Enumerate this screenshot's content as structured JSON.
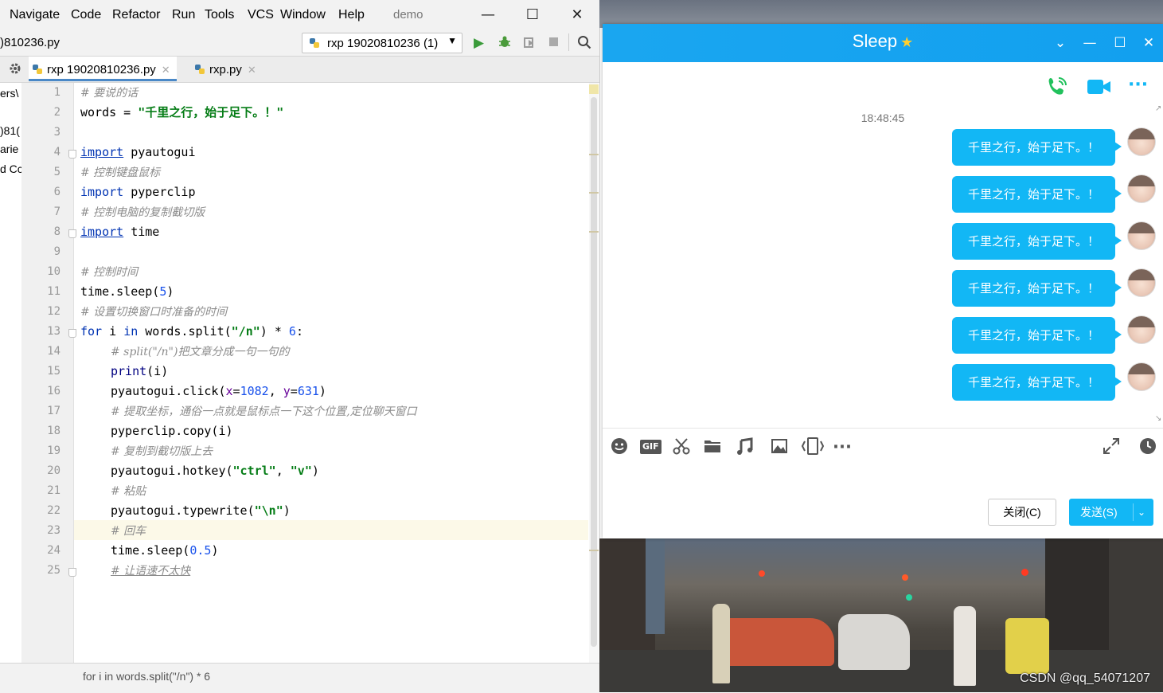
{
  "ide": {
    "menu": [
      "Navigate",
      "Code",
      "Refactor",
      "Run",
      "Tools",
      "VCS",
      "Window",
      "Help"
    ],
    "project": "demo",
    "window_controls": {
      "minimize": "—",
      "maximize": "☐",
      "close": "✕"
    },
    "nav_file": ")810236.py",
    "run_config": "rxp 19020810236 (1)",
    "tabs": [
      {
        "label": "rxp 19020810236.py",
        "close": "✕"
      },
      {
        "label": "rxp.py",
        "close": "✕"
      }
    ],
    "project_strip": [
      "ers\\",
      ")81(",
      "arie",
      "d Cc"
    ],
    "lines": [
      "1",
      "2",
      "3",
      "4",
      "5",
      "6",
      "7",
      "8",
      "9",
      "10",
      "11",
      "12",
      "13",
      "14",
      "15",
      "16",
      "17",
      "18",
      "19",
      "20",
      "21",
      "22",
      "23",
      "24",
      "25"
    ],
    "code": {
      "l1": "# 要说的话",
      "l2_a": "words = ",
      "l2_b": "\"千里之行，始于足下。！\"",
      "l4_kw": "import",
      "l4_rest": " pyautogui",
      "l5": "# 控制键盘鼠标",
      "l6_kw": "import",
      "l6_rest": " pyperclip",
      "l7": "# 控制电脑的复制截切版",
      "l8_kw": "import",
      "l8_rest": " time",
      "l10": "# 控制时间",
      "l11_a": "time.sleep(",
      "l11_num": "5",
      "l11_b": ")",
      "l12": "# 设置切换窗口时准备的时间",
      "l13_for": "for",
      "l13_a": " i ",
      "l13_in": "in",
      "l13_b": " words.split(",
      "l13_str": "\"/n\"",
      "l13_c": ") * ",
      "l13_num": "6",
      "l13_d": ":",
      "l14": "# split(\"/n\")把文章分成一句一句的",
      "l15_fn": "print",
      "l15_rest": "(i)",
      "l16_a": "pyautogui.click(",
      "l16_x": "x",
      "l16_eq1": "=",
      "l16_xv": "1082",
      "l16_sep": ", ",
      "l16_y": "y",
      "l16_eq2": "=",
      "l16_yv": "631",
      "l16_b": ")",
      "l17": "# 提取坐标，通俗一点就是鼠标点一下这个位置,定位聊天窗口",
      "l18": "pyperclip.copy(i)",
      "l19": "# 复制到截切版上去",
      "l20_a": "pyautogui.hotkey(",
      "l20_s1": "\"ctrl\"",
      "l20_sep": ", ",
      "l20_s2": "\"v\"",
      "l20_b": ")",
      "l21": "# 粘贴",
      "l22_a": "pyautogui.typewrite(",
      "l22_s": "\"\\n\"",
      "l22_b": ")",
      "l23": "# 回车",
      "l24_a": "time.sleep(",
      "l24_num": "0.5",
      "l24_b": ")",
      "l25": "# 让语速不太快"
    },
    "status": "for i in words.split(\"/n\") * 6"
  },
  "chat": {
    "title": "Sleep",
    "title_star": "★",
    "header_buttons": {
      "dropdown": "⌄",
      "minimize": "—",
      "maximize": "☐",
      "close": "✕"
    },
    "timestamp": "18:48:45",
    "messages": [
      "千里之行，始于足下。！",
      "千里之行，始于足下。！",
      "千里之行，始于足下。！",
      "千里之行，始于足下。！",
      "千里之行，始于足下。！",
      "千里之行，始于足下。！"
    ],
    "toolbar_gif": "GIF",
    "toolbar_more": "···",
    "more_top": "···",
    "close_button": "关闭(C)",
    "send_button": "发送(S)",
    "send_dropdown": "⌄",
    "accent": "#12b7f5"
  },
  "watermark": "CSDN @qq_54071207"
}
